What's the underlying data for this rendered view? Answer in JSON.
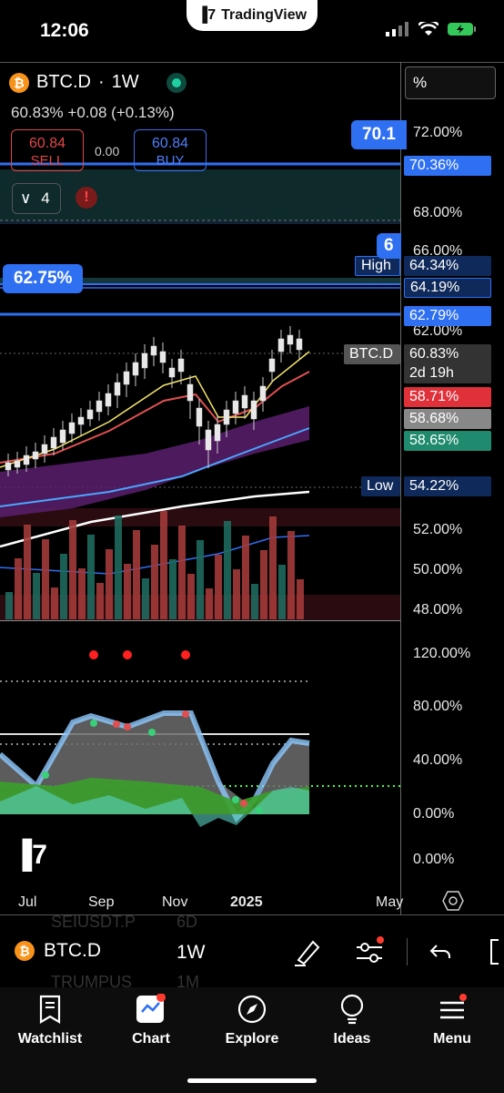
{
  "status_bar": {
    "time": "12:06",
    "app_pill": "TradingView"
  },
  "header": {
    "symbol": "BTC.D",
    "interval": "1W",
    "price": "60.83%",
    "change": "+0.08",
    "change_pct": "(+0.13%)",
    "sell_price": "60.84",
    "sell_label": "SELL",
    "spread": "0.00",
    "buy_price": "60.84",
    "buy_label": "BUY",
    "indicator_count": "4",
    "alert_glyph": "!",
    "scale_mode": "%"
  },
  "callouts": {
    "left": "62.75%",
    "top": "70.1",
    "mid": "6"
  },
  "price_axis": {
    "ticks": [
      "72.00%",
      "68.00%",
      "66.00%",
      "62.00%",
      "52.00%",
      "50.00%",
      "48.00%",
      "120.00%",
      "80.00%",
      "40.00%",
      "0.00%",
      "0.00%"
    ],
    "tags": {
      "t7036": "70.36%",
      "high_label": "High",
      "high": "64.34%",
      "t6419": "64.19%",
      "t6279": "62.79%",
      "symbol_label": "BTC.D",
      "last": "60.83%",
      "countdown": "2d 19h",
      "t5871": "58.71%",
      "t5868": "58.68%",
      "t5865": "58.65%",
      "low_label": "Low",
      "low": "54.22%"
    }
  },
  "time_axis": [
    "Jul",
    "Sep",
    "Nov",
    "2025",
    "May"
  ],
  "toolbar": {
    "symbol": "BTC.D",
    "interval": "1W",
    "ghost_symbol_1": "SEIUSDT.P",
    "ghost_interval_1": "6D",
    "ghost_symbol_2": "TRUMPUS",
    "ghost_interval_2": "1M"
  },
  "nav": [
    {
      "label": "Watchlist"
    },
    {
      "label": "Chart"
    },
    {
      "label": "Explore"
    },
    {
      "label": "Ideas"
    },
    {
      "label": "Menu"
    }
  ],
  "colors": {
    "accent_blue": "#2f6ff2",
    "sell_red": "#e04848",
    "buy_green": "#1f8a6e",
    "bitcoin_orange": "#f7931a"
  }
}
